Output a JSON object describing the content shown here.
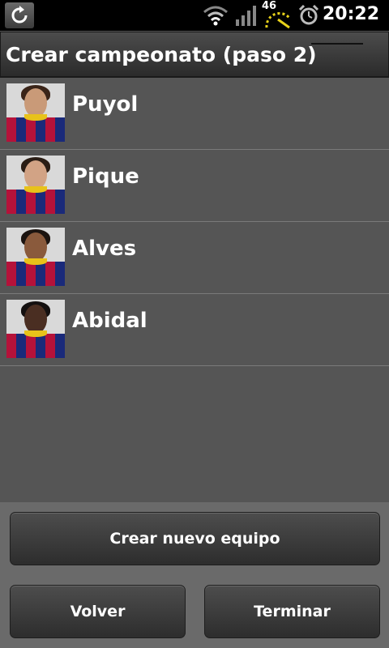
{
  "status_bar": {
    "network_label": "46",
    "time": "20:22",
    "icons": [
      "sync-icon",
      "wifi-icon",
      "signal-icon",
      "speedometer-icon",
      "alarm-icon"
    ]
  },
  "title_bar": {
    "title": "Crear campeonato (paso 2)"
  },
  "players": [
    {
      "name": "Puyol",
      "skin": "#c99a78",
      "hair": "#3a2418"
    },
    {
      "name": "Pique",
      "skin": "#d2a385",
      "hair": "#2a1d15"
    },
    {
      "name": "Alves",
      "skin": "#8a5a3c",
      "hair": "#1c1410"
    },
    {
      "name": "Abidal",
      "skin": "#4a2e22",
      "hair": "#141010"
    }
  ],
  "buttons": {
    "new_team": "Crear nuevo equipo",
    "back": "Volver",
    "finish": "Terminar"
  },
  "colors": {
    "background": "#555555",
    "bottom_panel": "#6a6a6a",
    "button": "#3a3a3a",
    "status_bar": "#000000"
  }
}
